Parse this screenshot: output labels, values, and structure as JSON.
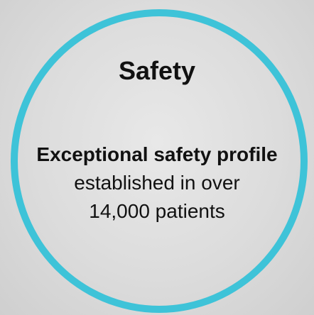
{
  "title": "Safety",
  "body": {
    "line1": "Exceptional safety profile",
    "line2": "established in over",
    "line3": "14,000 patients"
  },
  "colors": {
    "ring": "#3ec3d8",
    "text": "#111111",
    "background": "#dcdcdc"
  }
}
